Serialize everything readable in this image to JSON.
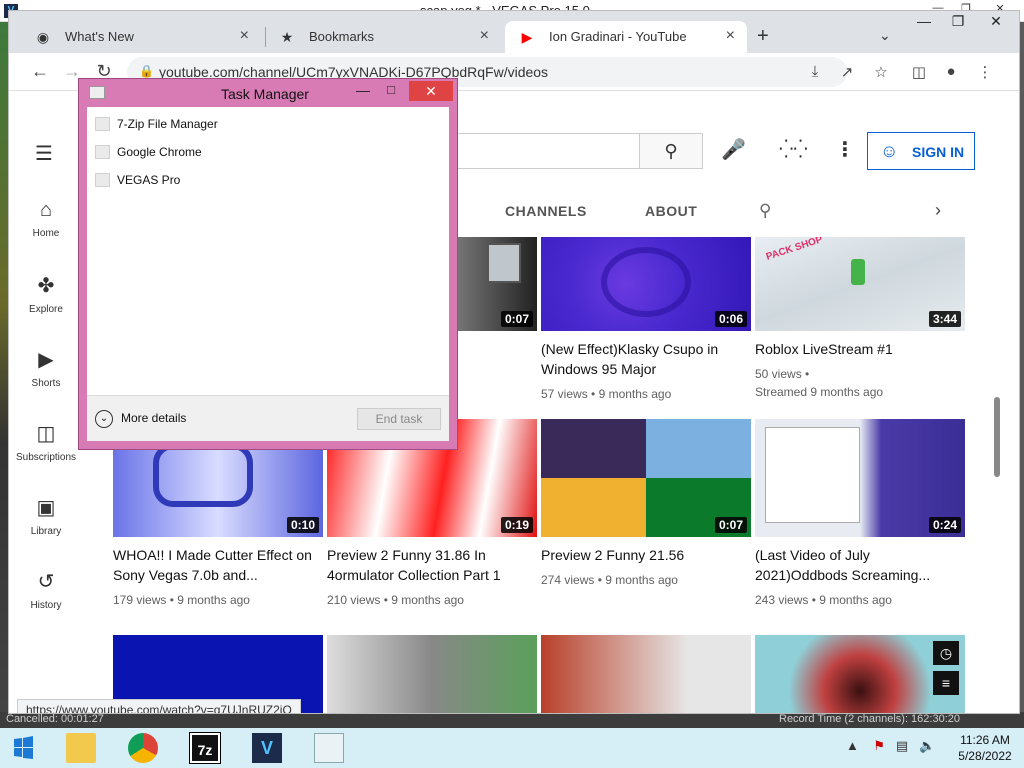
{
  "vegas": {
    "title": "scap.veg * - VEGAS Pro 15.0",
    "status_left": "Cancelled: 00:01:27",
    "status_right": "Record Time (2 channels): 162:30:20"
  },
  "chrome": {
    "tabs": [
      {
        "label": "What's New",
        "icon": "chrome-icon"
      },
      {
        "label": "Bookmarks",
        "icon": "star-icon"
      },
      {
        "label": "Ion Gradinari - YouTube",
        "icon": "youtube-icon"
      }
    ],
    "url": "youtube.com/channel/UCm7yxVNADKi-D67PQbdRqFw/videos",
    "status_url": "https://www.youtube.com/watch?v=q7UJnRUZ2iQ"
  },
  "youtube": {
    "sidebar": [
      {
        "label": "Home",
        "icon": "home-icon"
      },
      {
        "label": "Explore",
        "icon": "compass-icon"
      },
      {
        "label": "Shorts",
        "icon": "shorts-icon"
      },
      {
        "label": "Subscriptions",
        "icon": "subscriptions-icon"
      },
      {
        "label": "Library",
        "icon": "library-icon"
      },
      {
        "label": "History",
        "icon": "history-icon"
      }
    ],
    "sign_in": "SIGN IN",
    "channel_tabs": {
      "channels": "CHANNELS",
      "about": "ABOUT"
    },
    "videos": [
      {
        "title": "",
        "views": "",
        "age": "",
        "duration": "0:07"
      },
      {
        "title": "(New Effect)Klasky Csupo in Windows 95 Major",
        "views": "57 views",
        "age": "9 months ago",
        "duration": "0:06"
      },
      {
        "title": "Roblox LiveStream #1",
        "views": "50 views",
        "age": "Streamed 9 months ago",
        "duration": "3:44"
      },
      {
        "title": "WHOA!! I Made Cutter Effect on Sony Vegas 7.0b and...",
        "views": "179 views",
        "age": "9 months ago",
        "duration": "0:10"
      },
      {
        "title": "Preview 2 Funny 31.86 In 4ormulator Collection Part 1",
        "views": "210 views",
        "age": "9 months ago",
        "duration": "0:19"
      },
      {
        "title": "Preview 2 Funny 21.56",
        "views": "274 views",
        "age": "9 months ago",
        "duration": "0:07"
      },
      {
        "title": "(Last Video of July 2021)Oddbods Screaming...",
        "views": "243 views",
        "age": "9 months ago",
        "duration": "0:24"
      }
    ]
  },
  "task_manager": {
    "title": "Task Manager",
    "apps": [
      "7-Zip File Manager",
      "Google Chrome",
      "VEGAS Pro"
    ],
    "more_details": "More details",
    "end_task": "End task"
  },
  "taskbar": {
    "apps": [
      "File Explorer",
      "Google Chrome",
      "7-Zip",
      "VEGAS Pro",
      "Task Manager"
    ],
    "time": "11:26 AM",
    "date": "5/28/2022"
  },
  "colors": {
    "task_manager_frame": "#d87bb4",
    "youtube_blue": "#065fd4",
    "taskbar": "#d6eef5"
  }
}
